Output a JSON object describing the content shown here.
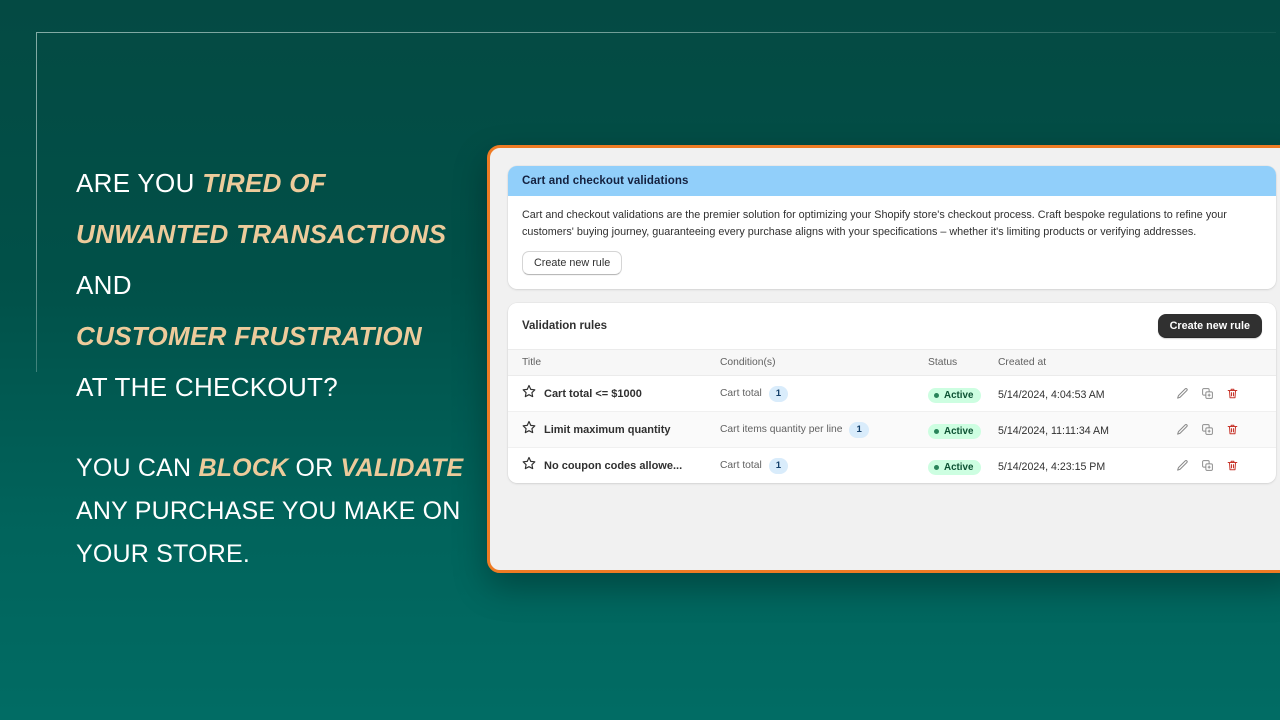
{
  "marketing": {
    "headline_parts": [
      {
        "text": "ARE YOU ",
        "em": false
      },
      {
        "text": "TIRED OF",
        "em": true
      },
      {
        "text": " ",
        "em": false
      },
      {
        "text": "UNWANTED TRANSACTIONS",
        "em": true
      },
      {
        "text": " AND ",
        "em": false
      },
      {
        "text": "CUSTOMER FRUSTRATION",
        "em": true
      },
      {
        "text": " AT THE CHECKOUT?",
        "em": false
      }
    ],
    "line1_a": "ARE YOU ",
    "line1_b": "TIRED OF",
    "line2": "UNWANTED TRANSACTIONS",
    "line2_tail": " AND ",
    "line3": "CUSTOMER FRUSTRATION",
    "line4": " AT THE CHECKOUT?",
    "sub_a": "YOU CAN ",
    "sub_b": "BLOCK",
    "sub_c": " OR ",
    "sub_d": "VALIDATE",
    "sub_e": " ANY PURCHASE YOU MAKE ON YOUR STORE."
  },
  "banner": {
    "title": "Cart and checkout validations",
    "description": "Cart and checkout validations are the premier solution for optimizing your Shopify store's checkout process. Craft bespoke regulations to refine your customers' buying journey, guaranteeing every purchase aligns with your specifications – whether it's limiting products or verifying addresses.",
    "create_button": "Create new rule"
  },
  "rules_card": {
    "title": "Validation rules",
    "create_button": "Create new rule",
    "columns": [
      "Title",
      "Condition(s)",
      "Status",
      "Created at"
    ],
    "rows": [
      {
        "title": "Cart total <= $1000",
        "condition_label": "Cart total",
        "condition_count": "1",
        "status": "Active",
        "created_at": "5/14/2024, 4:04:53 AM"
      },
      {
        "title": "Limit maximum quantity",
        "condition_label": "Cart items quantity per line",
        "condition_count": "1",
        "status": "Active",
        "created_at": "5/14/2024, 11:11:34 AM"
      },
      {
        "title": "No coupon codes allowe...",
        "condition_label": "Cart total",
        "condition_count": "1",
        "status": "Active",
        "created_at": "5/14/2024, 4:23:15 PM"
      }
    ],
    "row_actions": [
      "edit-icon",
      "duplicate-icon",
      "delete-icon"
    ]
  },
  "colors": {
    "background_top": "#044a43",
    "background_bottom": "#016c64",
    "accent_gold": "#edcb9b",
    "window_border": "#ef7b24",
    "banner_header": "#91cffa",
    "status_bg": "#cdfee1",
    "status_text": "#0c5132",
    "badge_bg": "#d9ecfb",
    "dark_button": "#303030",
    "delete_icon": "#c7352b"
  }
}
